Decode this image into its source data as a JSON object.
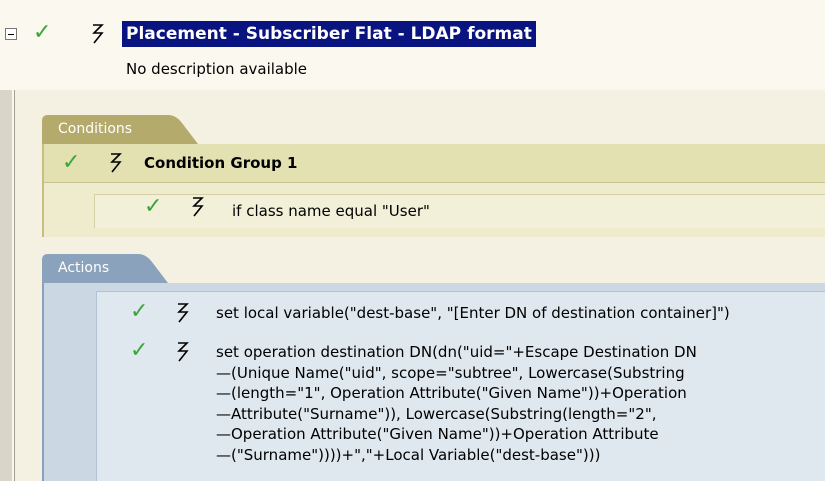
{
  "rule": {
    "title": "Placement - Subscriber Flat - LDAP format",
    "description": "No description available",
    "icons": [
      "collapse-icon",
      "check-icon",
      "lightning-icon"
    ]
  },
  "conditions": {
    "tab_label": "Conditions",
    "group": {
      "label": "Condition Group 1"
    },
    "items": [
      "if class name equal \"User\""
    ]
  },
  "actions": {
    "tab_label": "Actions",
    "items": [
      {
        "lines": [
          "set local variable(\"dest-base\", \"[Enter DN of destination container]\")"
        ]
      },
      {
        "lines": [
          "set operation destination DN(dn(\"uid=\"+Escape Destination DN",
          "—(Unique Name(\"uid\", scope=\"subtree\", Lowercase(Substring",
          "—(length=\"1\", Operation Attribute(\"Given Name\"))+Operation",
          "—Attribute(\"Surname\")), Lowercase(Substring(length=\"2\",",
          "—Operation Attribute(\"Given Name\"))+Operation Attribute",
          "—(\"Surname\"))))+\",\"+Local Variable(\"dest-base\")))"
        ]
      }
    ]
  },
  "colors": {
    "title_bg": "#0a1480",
    "check": "#3aa63a",
    "conditions_tab": "#b4aa6b",
    "actions_tab": "#8aa2bb"
  }
}
